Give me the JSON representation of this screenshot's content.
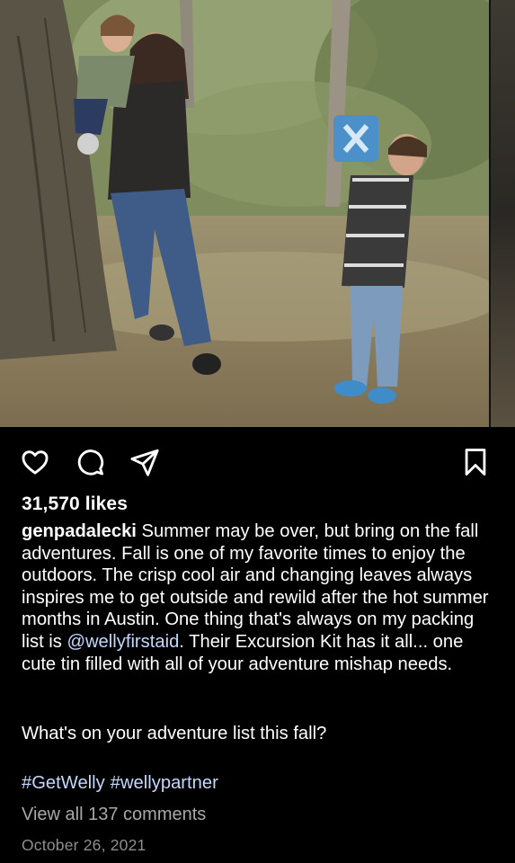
{
  "post": {
    "likes_text": "31,570 likes",
    "username": "genpadalecki",
    "caption_part1": " Summer may be over, but bring on the fall adventures. Fall is one of my favorite times to enjoy the outdoors. The crisp cool air and changing leaves always inspires me to get outside and rewild after the hot summer months in Austin. One thing that's always on my packing list is ",
    "mention": "@wellyfirstaid",
    "caption_part2": ". Their Excursion Kit has it all... one cute tin filled with all of your adventure mishap needs.",
    "question": "What's on your adventure list this fall?",
    "hashtags": [
      "#GetWelly",
      "#wellypartner"
    ],
    "view_comments": "View all 137 comments",
    "date": "October 26, 2021"
  },
  "icons": {
    "like": "heart-icon",
    "comment": "comment-bubble-icon",
    "share": "paper-plane-icon",
    "save": "bookmark-icon"
  },
  "colors": {
    "background": "#000000",
    "text": "#ffffff",
    "link": "#c4d8ff",
    "secondary_text": "#a8a8a8",
    "date_text": "#8e8e8e"
  }
}
